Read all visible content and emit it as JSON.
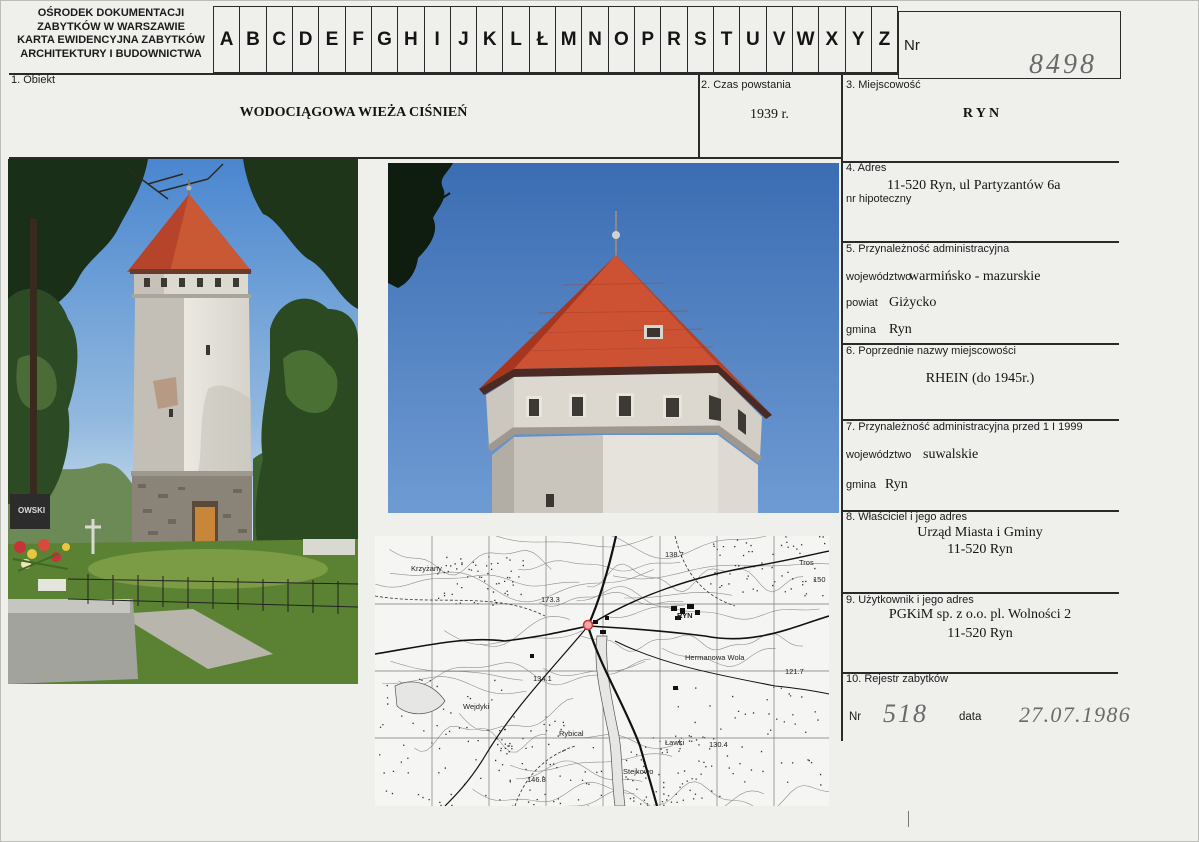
{
  "header": {
    "org_lines": [
      "OŚRODEK DOKUMENTACJI",
      "ZABYTKÓW W WARSZAWIE",
      "KARTA EWIDENCYJNA ZABYTKÓW",
      "ARCHITEKTURY I BUDOWNICTWA"
    ],
    "letters": [
      "A",
      "B",
      "C",
      "D",
      "E",
      "F",
      "G",
      "H",
      "I",
      "J",
      "K",
      "L",
      "Ł",
      "M",
      "N",
      "O",
      "P",
      "R",
      "S",
      "T",
      "U",
      "V",
      "W",
      "X",
      "Y",
      "Z"
    ],
    "nr_label": "Nr",
    "nr_value": "8498"
  },
  "fields": {
    "obiekt": {
      "label": "1. Obiekt",
      "value": "WODOCIĄGOWA WIEŻA CIŚNIEŃ"
    },
    "czas": {
      "label": "2. Czas powstania",
      "value": "1939 r."
    },
    "miejscowosc": {
      "label": "3. Miejscowość",
      "value": "R Y N"
    },
    "adres": {
      "label": "4. Adres",
      "value": "11-520 Ryn, ul Partyzantów 6a",
      "hipoteczny_label": "nr hipoteczny"
    },
    "admin": {
      "label": "5. Przynależność administracyjna",
      "wojewodztwo_label": "województwo",
      "wojewodztwo": "warmińsko - mazurskie",
      "powiat_label": "powiat",
      "powiat": "Giżycko",
      "gmina_label": "gmina",
      "gmina": "Ryn"
    },
    "poprzednie": {
      "label": "6. Poprzednie nazwy miejscowości",
      "value": "RHEIN (do 1945r.)"
    },
    "admin_przed": {
      "label": "7. Przynależność administracyjna przed 1 I 1999",
      "wojewodztwo_label": "województwo",
      "wojewodztwo": "suwalskie",
      "gmina_label": "gmina",
      "gmina": "Ryn"
    },
    "wlasciciel": {
      "label": "8. Właściciel i jego adres",
      "line1": "Urząd Miasta i Gminy",
      "line2": "11-520 Ryn"
    },
    "uzytkownik": {
      "label": "9. Użytkownik i jego adres",
      "line1": "PGKiM sp. z o.o. pl. Wolności 2",
      "line2": "11-520 Ryn"
    },
    "rejestr": {
      "label": "10. Rejestr zabytków",
      "nr_label": "Nr",
      "nr": "518",
      "data_label": "data",
      "data": "27.07.1986"
    }
  },
  "photos": {
    "gravestone_text": "OWSKI"
  },
  "map": {
    "labels": [
      "Krzyżany",
      "173.3",
      "138.7",
      "Tros",
      "150",
      "RYN",
      "Hermanowa Wola",
      "134.1",
      "Wejdyki",
      "Rybical",
      "Ławki",
      "130.4",
      "121.7",
      "146.8",
      "Stejkowo"
    ]
  },
  "colors": {
    "paper": "#efefec",
    "rule": "#2a2a2a",
    "handwriting": "#6a6a6a",
    "roof": "#c95834",
    "map_marker": "#d0342c"
  }
}
